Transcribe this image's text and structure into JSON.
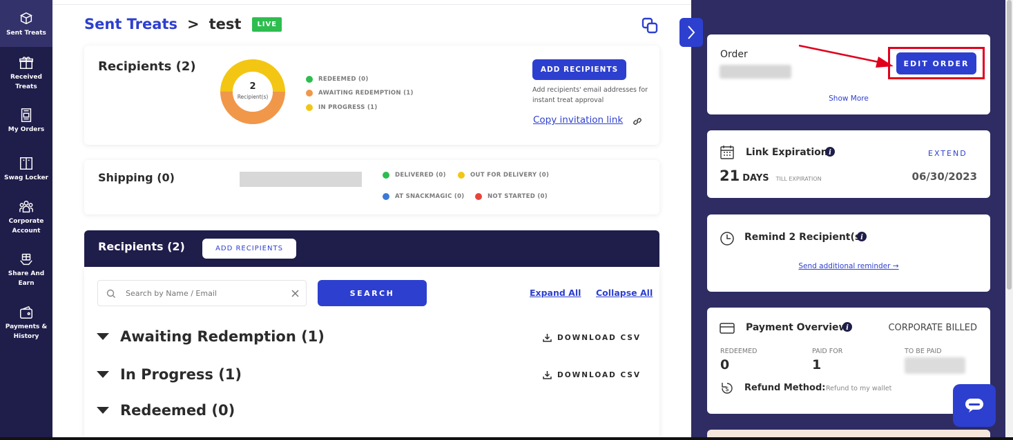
{
  "sidebar": {
    "items": [
      {
        "label": "Sent Treats",
        "icon": "gift-box-icon"
      },
      {
        "label": "Received Treats",
        "icon": "gift-icon"
      },
      {
        "label": "My Orders",
        "icon": "receipt-icon"
      },
      {
        "label": "Swag Locker",
        "icon": "locker-icon"
      },
      {
        "label": "Corporate Account",
        "icon": "people-icon"
      },
      {
        "label": "Share And Earn",
        "icon": "hand-gift-icon"
      },
      {
        "label": "Payments & History",
        "icon": "wallet-icon"
      }
    ]
  },
  "header": {
    "breadcrumb_link": "Sent Treats",
    "separator": ">",
    "current": "test",
    "badge": "LIVE"
  },
  "recipients_card": {
    "title": "Recipients (2)",
    "donut_count": "2",
    "donut_label": "Recipient(s)",
    "legend": [
      {
        "label": "REDEEMED (0)",
        "color": "#2ebd4f"
      },
      {
        "label": "AWAITING REDEMPTION (1)",
        "color": "#f0974a"
      },
      {
        "label": "IN PROGRESS (1)",
        "color": "#f3c613"
      }
    ],
    "add_button": "ADD RECIPIENTS",
    "add_help": "Add recipients' email addresses for instant treat approval",
    "copy_link": "Copy invitation link"
  },
  "shipping_card": {
    "title": "Shipping (0)",
    "legend": [
      {
        "label": "DELIVERED (0)",
        "color": "#2ebd4f"
      },
      {
        "label": "OUT FOR DELIVERY (0)",
        "color": "#f3c613"
      },
      {
        "label": "AT SNACKMAGIC (0)",
        "color": "#3a7bd5"
      },
      {
        "label": "NOT STARTED (0)",
        "color": "#e8443a"
      }
    ]
  },
  "recipients_list": {
    "title": "Recipients (2)",
    "add_button": "ADD RECIPIENTS",
    "search_placeholder": "Search by Name / Email",
    "search_button": "SEARCH",
    "expand_all": "Expand All",
    "collapse_all": "Collapse All",
    "download_label": "DOWNLOAD CSV",
    "groups": [
      {
        "title": "Awaiting Redemption (1)"
      },
      {
        "title": "In Progress (1)"
      },
      {
        "title": "Redeemed (0)"
      }
    ]
  },
  "order_card": {
    "label": "Order",
    "edit_button": "EDIT ORDER",
    "show_more": "Show More"
  },
  "expiration_card": {
    "title": "Link Expiration",
    "extend": "EXTEND",
    "days_number": "21",
    "days_word": "DAYS",
    "till": "TILL EXPIRATION",
    "date": "06/30/2023"
  },
  "remind_card": {
    "title": "Remind 2 Recipient(s)",
    "link": "Send additional reminder →"
  },
  "payment_card": {
    "title": "Payment Overview",
    "billing": "CORPORATE BILLED",
    "redeemed_label": "REDEEMED",
    "redeemed_value": "0",
    "paid_label": "PAID FOR",
    "paid_value": "1",
    "tobe_label": "TO BE PAID",
    "refund_label": "Refund Method:",
    "refund_value": "Refund to my wallet"
  },
  "colors": {
    "brand_blue": "#2d3fcf",
    "navy": "#1f1d4a",
    "panel": "#2e2c62",
    "highlight": "#e0001b"
  }
}
